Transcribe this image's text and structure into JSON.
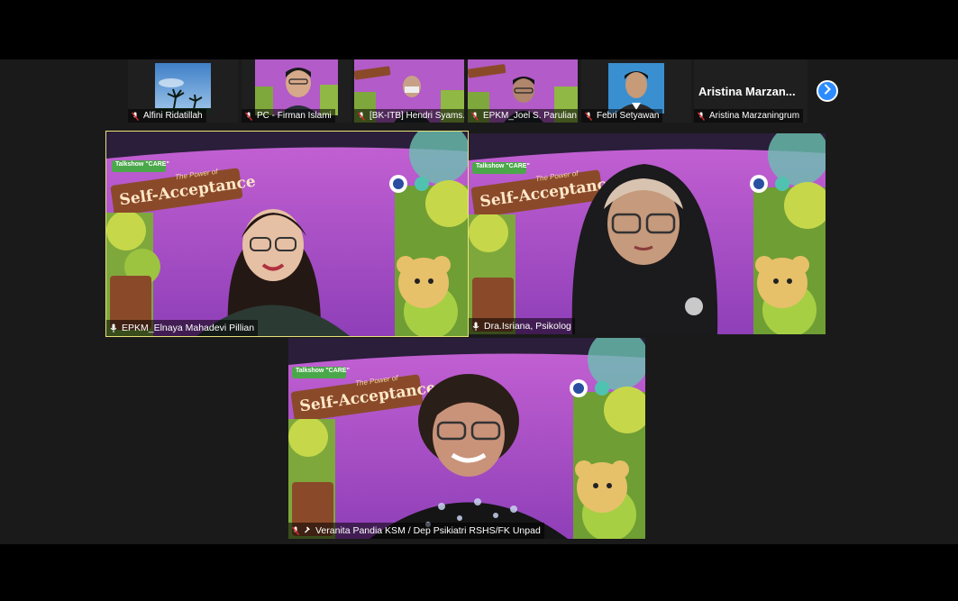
{
  "thumbnails": [
    {
      "name": "Alfini Ridatillah",
      "muted": true
    },
    {
      "name": "PC - Firman Islami",
      "muted": true
    },
    {
      "name": "[BK-ITB] Hendri Syams...",
      "muted": true
    },
    {
      "name": "EPKM_Joel S. Parulian",
      "muted": true
    },
    {
      "name": "Febri Setyawan",
      "muted": true
    },
    {
      "name": "Aristina Marzaningrum",
      "muted": true
    }
  ],
  "name_only_tile": {
    "display_name": "Aristina  Marzan..."
  },
  "next_page_icon": "chevron-right-icon",
  "banner": {
    "tag": "Talkshow \"CARE\"",
    "line1": "The Power of",
    "line2": "Self-Acceptance"
  },
  "speakers": [
    {
      "name": "EPKM_Elnaya Mahadevi Pillian",
      "active": true
    },
    {
      "name": "Dra.Isriana, Psikolog",
      "active": false
    },
    {
      "name": "Veranita Pandia KSM / Dep Psikiatri RSHS/FK Unpad",
      "active": false
    }
  ],
  "colors": {
    "active_speaker_border": "#e8e27a",
    "next_button": "#2d8cff",
    "background_top": "#c35fd3",
    "background_bottom": "#8d3db6"
  }
}
